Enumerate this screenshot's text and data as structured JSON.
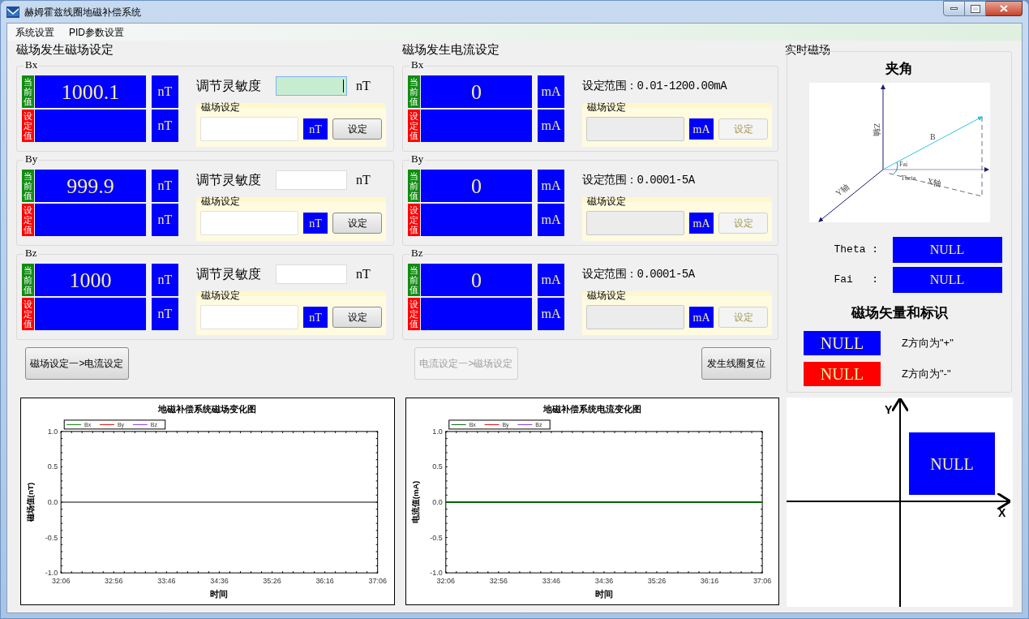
{
  "window": {
    "title": "赫姆霍兹线圈地磁补偿系统"
  },
  "menu": [
    "系统设置",
    "PID参数设置"
  ],
  "field_section": {
    "title": "磁场发生磁场设定",
    "groups": [
      {
        "label": "Bx",
        "current_label": "当前值",
        "set_label": "设定值",
        "current_value": "1000.1",
        "unit": "nT",
        "set_unit": "nT",
        "sensitivity_label": "调节灵敏度",
        "sensitivity_unit": "nT",
        "sensitivity_focused": true,
        "setting_title": "磁场设定",
        "setting_unit": "nT",
        "button": "设定",
        "disabled": false
      },
      {
        "label": "By",
        "current_label": "当前值",
        "set_label": "设定值",
        "current_value": "999.9",
        "unit": "nT",
        "set_unit": "nT",
        "sensitivity_label": "调节灵敏度",
        "sensitivity_unit": "nT",
        "sensitivity_focused": false,
        "setting_title": "磁场设定",
        "setting_unit": "nT",
        "button": "设定",
        "disabled": false
      },
      {
        "label": "Bz",
        "current_label": "当前值",
        "set_label": "设定值",
        "current_value": "1000",
        "unit": "nT",
        "set_unit": "nT",
        "sensitivity_label": "调节灵敏度",
        "sensitivity_unit": "nT",
        "sensitivity_focused": false,
        "setting_title": "磁场设定",
        "setting_unit": "nT",
        "button": "设定",
        "disabled": false
      }
    ]
  },
  "current_section": {
    "title": "磁场发生电流设定",
    "groups": [
      {
        "label": "Bx",
        "current_label": "当前值",
        "set_label": "设定值",
        "current_value": "0",
        "unit": "mA",
        "set_unit": "mA",
        "range": "设定范围：0.01-1200.00mA",
        "setting_title": "磁场设定",
        "setting_unit": "mA",
        "button": "设定",
        "disabled": true
      },
      {
        "label": "By",
        "current_label": "当前值",
        "set_label": "设定值",
        "current_value": "0",
        "unit": "mA",
        "set_unit": "mA",
        "range": "设定范围：0.0001-5A",
        "setting_title": "磁场设定",
        "setting_unit": "mA",
        "button": "设定",
        "disabled": true
      },
      {
        "label": "Bz",
        "current_label": "当前值",
        "set_label": "设定值",
        "current_value": "0",
        "unit": "mA",
        "set_unit": "mA",
        "range": "设定范围：0.0001-5A",
        "setting_title": "磁场设定",
        "setting_unit": "mA",
        "button": "设定",
        "disabled": true
      }
    ]
  },
  "actions": [
    {
      "label": "磁场设定一>电流设定",
      "disabled": false
    },
    {
      "label": "电流设定一>磁场设定",
      "disabled": true
    },
    {
      "label": "发生线圈复位",
      "disabled": false
    }
  ],
  "charts": [
    {
      "chart_data": {
        "type": "line",
        "title": "地磁补偿系统磁场变化图",
        "xlabel": "时间",
        "ylabel": "磁场值(nT)",
        "ylim": [
          -1,
          1
        ],
        "yticks": [
          {
            "value": 1,
            "label": "1.0"
          },
          {
            "value": 0.5,
            "label": "0.5"
          },
          {
            "value": 0,
            "label": "0.0"
          },
          {
            "value": -0.5,
            "label": "-0.5"
          },
          {
            "value": -1,
            "label": "-1.0"
          }
        ],
        "categories": [
          "32:06",
          "32:56",
          "33:46",
          "34:36",
          "35:26",
          "36:16",
          "37:06"
        ],
        "series": [
          {
            "name": "Bx",
            "color": "#008000",
            "values": [
              null,
              null,
              null,
              null,
              null,
              null,
              null
            ]
          },
          {
            "name": "By",
            "color": "#e00000",
            "values": [
              null,
              null,
              null,
              null,
              null,
              null,
              null
            ]
          },
          {
            "name": "Bz",
            "color": "#8a2be2",
            "values": [
              null,
              null,
              null,
              null,
              null,
              null,
              null
            ]
          }
        ]
      }
    },
    {
      "chart_data": {
        "type": "line",
        "title": "地磁补偿系统电流变化图",
        "xlabel": "时间",
        "ylabel": "电流值(mA)",
        "ylim": [
          -1,
          1
        ],
        "yticks": [
          {
            "value": 1,
            "label": "1.0"
          },
          {
            "value": 0.5,
            "label": "0.5"
          },
          {
            "value": 0,
            "label": "0.0"
          },
          {
            "value": -0.5,
            "label": "-0.5"
          },
          {
            "value": -1,
            "label": "-1.0"
          }
        ],
        "categories": [
          "32:06",
          "32:56",
          "33:46",
          "34:36",
          "35:26",
          "36:16",
          "37:06"
        ],
        "series": [
          {
            "name": "Bx",
            "color": "#006400",
            "values": [
              0,
              0,
              0,
              0,
              0,
              0,
              0
            ]
          },
          {
            "name": "By",
            "color": "#e00000",
            "values": [
              null,
              null,
              null,
              null,
              null,
              null,
              null
            ]
          },
          {
            "name": "Bz",
            "color": "#8a2be2",
            "values": [
              null,
              null,
              null,
              null,
              null,
              null,
              null
            ]
          }
        ]
      }
    }
  ],
  "realtime": {
    "title": "实时磁场",
    "angle_title": "夹角",
    "diagram_labels": {
      "z": "Z轴",
      "b": "B",
      "fai": "Fai",
      "theta": "Theta",
      "x": "X轴",
      "y": "Y轴"
    },
    "angles": [
      {
        "label": "Theta :",
        "value": "NULL"
      },
      {
        "label": "Fai   :",
        "value": "NULL"
      }
    ],
    "legend_title": "磁场矢量和标识",
    "legend": [
      {
        "value": "NULL",
        "color": "#0000ff",
        "text": "Z方向为\"+\""
      },
      {
        "value": "NULL",
        "color": "#ff0000",
        "text": "Z方向为\"-\""
      }
    ]
  },
  "quadrant": {
    "y_label": "Y",
    "x_label": "X",
    "value": "NULL",
    "color": "#0000ff"
  }
}
